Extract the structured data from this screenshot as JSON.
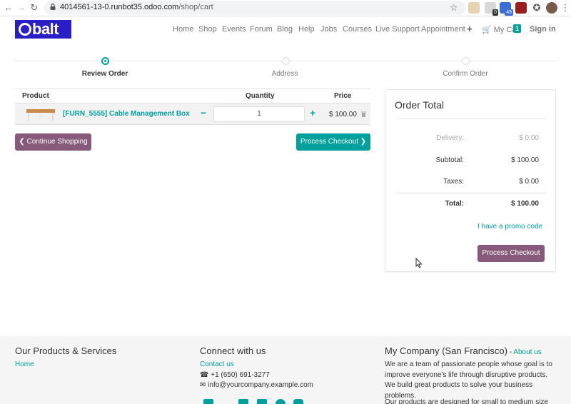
{
  "browser": {
    "url_host": "4014561-13-0.runbot35.odoo.com",
    "url_path": "/shop/cart",
    "ext_badge_1": "0",
    "ext_badge_2": "49"
  },
  "header": {
    "logo_text": "balt",
    "menu": [
      "Home",
      "Shop",
      "Events",
      "Forum",
      "Blog",
      "Help",
      "Jobs",
      "Courses",
      "Live Support",
      "Appointment"
    ],
    "cart_label": "My Cart",
    "cart_count": "1",
    "signin_label": "Sign in"
  },
  "wizard": {
    "steps": [
      "Review Order",
      "Address",
      "Confirm Order"
    ],
    "active_step": "Review Order"
  },
  "cart": {
    "headers": {
      "product": "Product",
      "quantity": "Quantity",
      "price": "Price"
    },
    "rows": [
      {
        "name": "[FURN_5555] Cable Management Box",
        "quantity": "1",
        "price": "$ 100.00"
      }
    ],
    "continue_label": "Continue Shopping",
    "checkout_label": "Process Checkout"
  },
  "order_total": {
    "title": "Order Total",
    "delivery_label": "Delivery:",
    "delivery_value": "$ 0.00",
    "subtotal_label": "Subtotal:",
    "subtotal_value": "$ 100.00",
    "taxes_label": "Taxes:",
    "taxes_value": "$ 0.00",
    "total_label": "Total:",
    "total_value": "$ 100.00",
    "promo_label": "I have a promo code",
    "checkout_label": "Process Checkout"
  },
  "footer": {
    "col1_title": "Our Products & Services",
    "col1_link": "Home",
    "col2_title": "Connect with us",
    "col2_contact": "Contact us",
    "col2_phone": "+1 (650) 691-3277",
    "col2_email": "info@yourcompany.example.com",
    "col3_title": "My Company (San Francisco)",
    "col3_about_sep": " - ",
    "col3_about": "About us",
    "col3_para1": "We are a team of passionate people whose goal is to improve everyone's life through disruptive products. We build great products to solve your business problems.",
    "col3_para2": "Our products are designed for small to medium size"
  },
  "colors": {
    "brand": "#2a1fc7",
    "teal": "#00a09d",
    "purple": "#875a7b"
  }
}
